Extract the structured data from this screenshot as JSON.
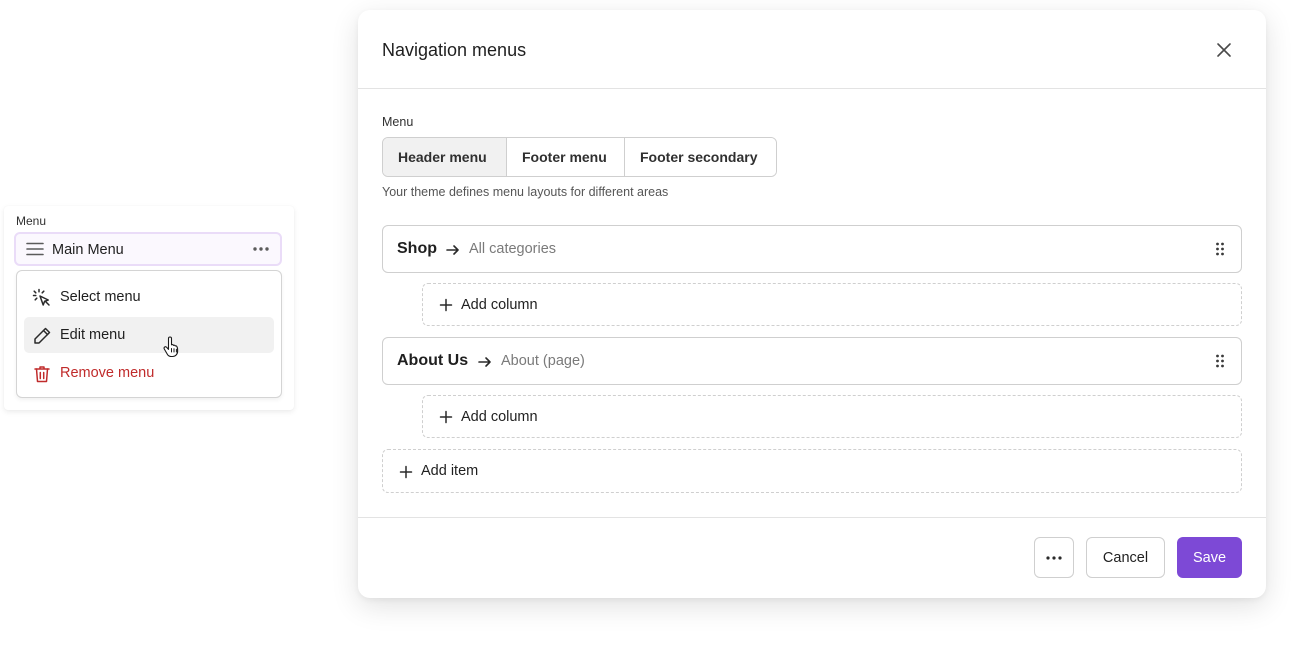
{
  "left_panel": {
    "label": "Menu",
    "menu_name": "Main Menu",
    "menu_icon": "hamburger-icon",
    "more_icon": "more-horizontal-icon",
    "dropdown": [
      {
        "label": "Select menu",
        "icon": "cursor-click-icon",
        "state": "normal"
      },
      {
        "label": "Edit menu",
        "icon": "pencil-icon",
        "state": "hover"
      },
      {
        "label": "Remove menu",
        "icon": "trash-icon",
        "state": "danger"
      }
    ]
  },
  "modal": {
    "title": "Navigation menus",
    "close_icon": "close-icon",
    "field_label": "Menu",
    "tabs": [
      {
        "label": "Header menu",
        "active": true
      },
      {
        "label": "Footer menu",
        "active": false
      },
      {
        "label": "Footer secondary",
        "active": false
      }
    ],
    "help_text": "Your theme defines menu layouts for different areas",
    "items": [
      {
        "name": "Shop",
        "target": "All categories",
        "add_label": "Add column"
      },
      {
        "name": "About Us",
        "target": "About (page)",
        "add_label": "Add column"
      }
    ],
    "add_item_label": "Add item",
    "footer": {
      "more_icon": "more-horizontal-icon",
      "cancel_label": "Cancel",
      "save_label": "Save"
    }
  },
  "colors": {
    "accent": "#7d49d6",
    "danger": "#c02b2b",
    "border": "#cfcfcf",
    "muted_text": "#7a7a7a",
    "highlight_border": "#eadcf8"
  }
}
